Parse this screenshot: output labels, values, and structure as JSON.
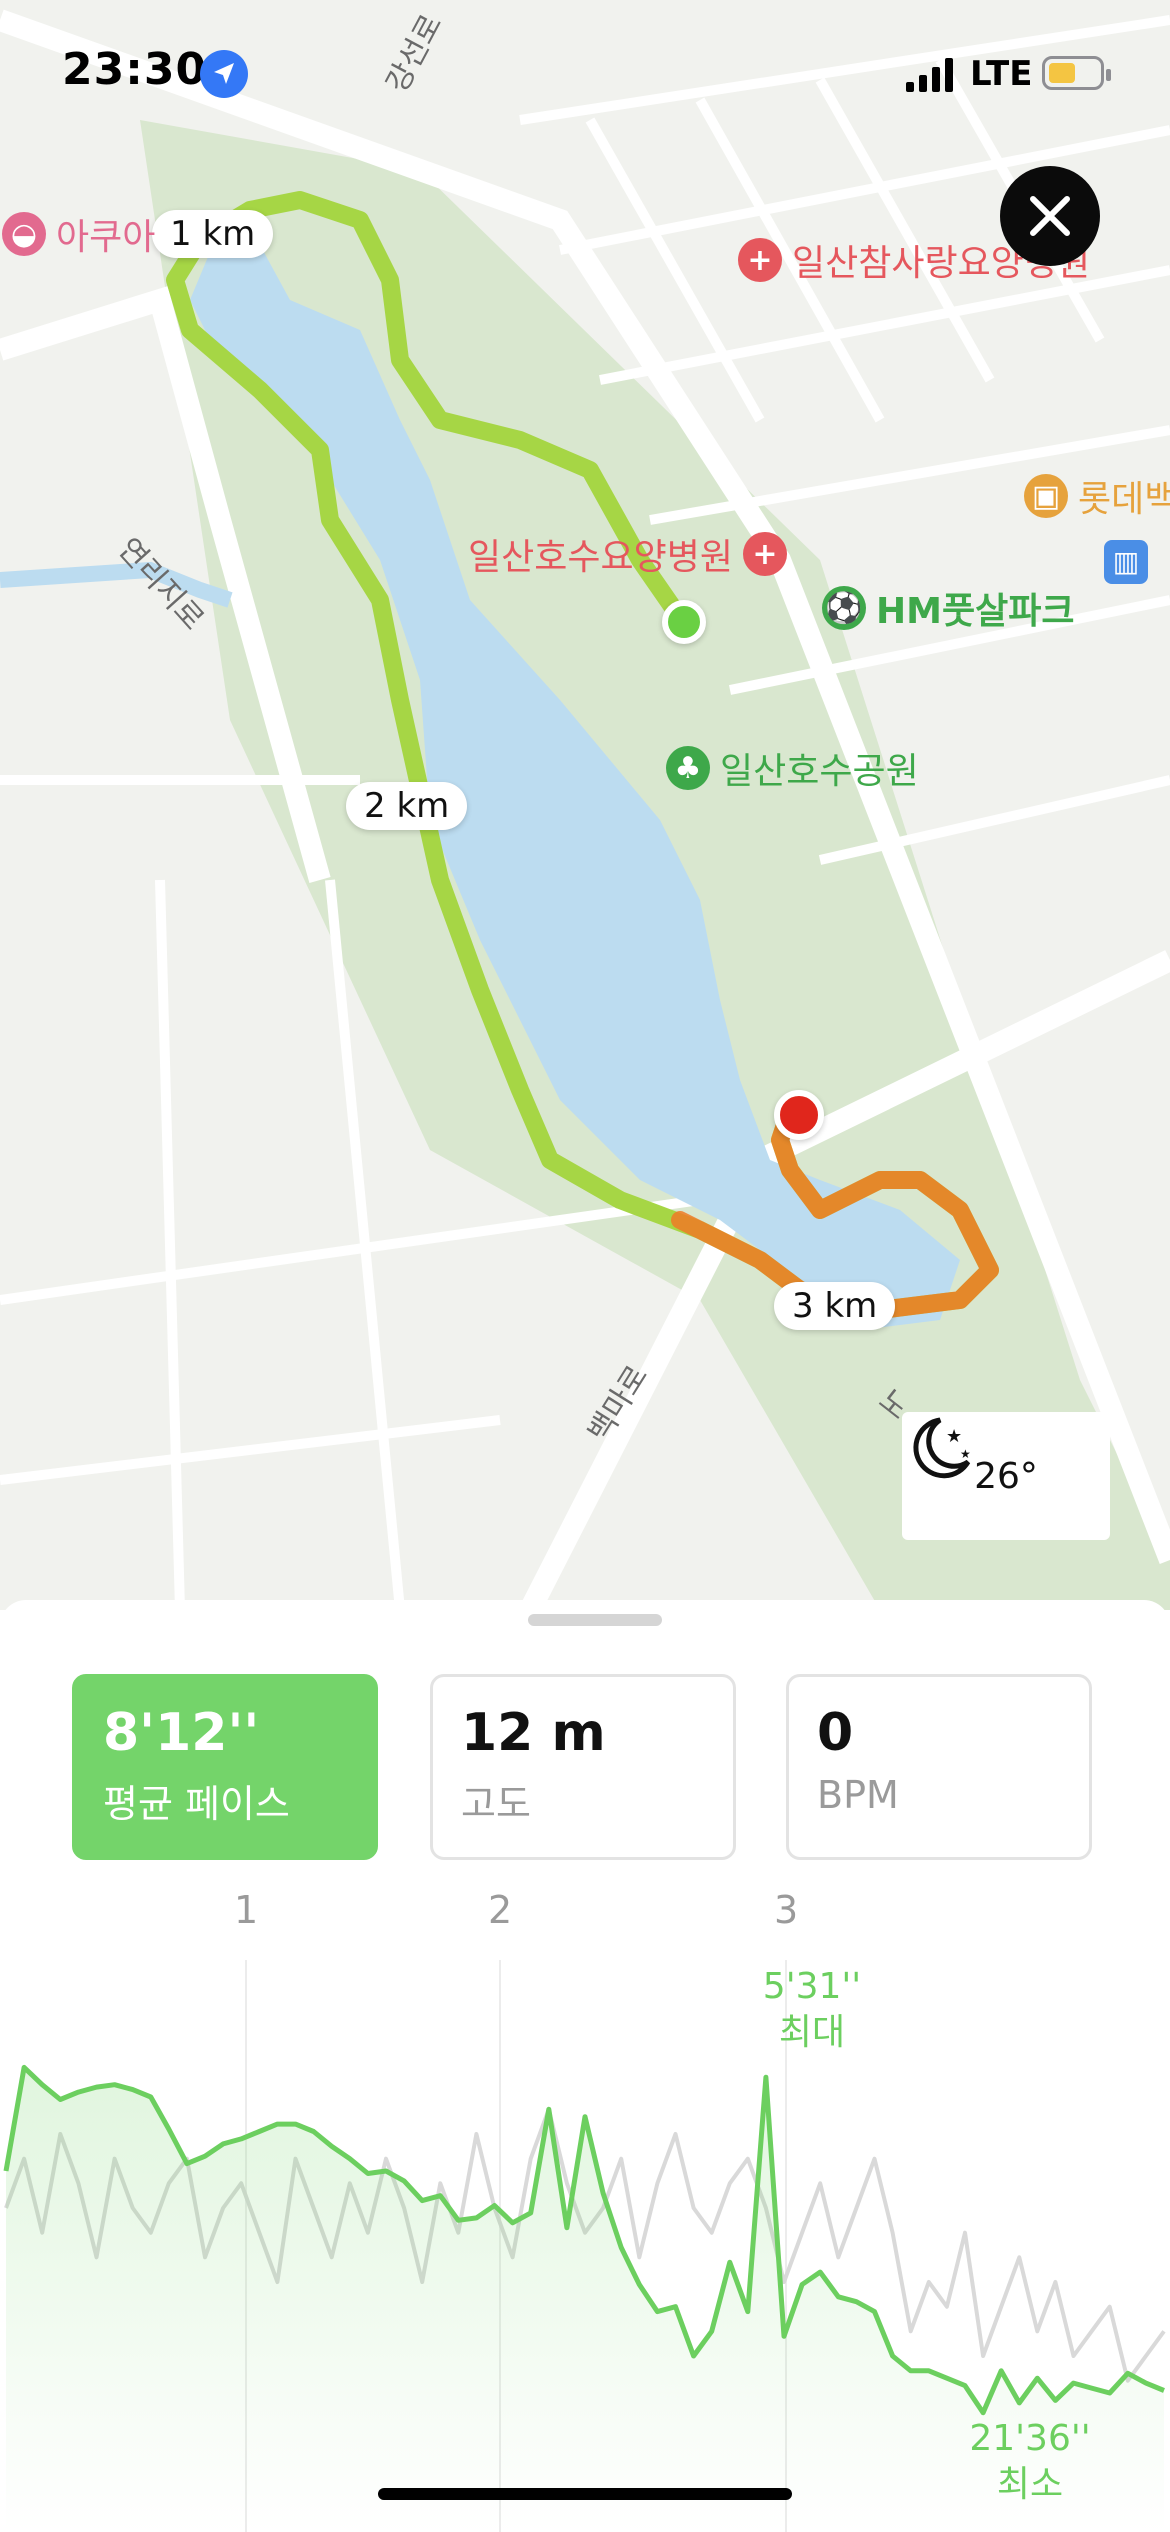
{
  "status": {
    "time": "23:30",
    "network": "LTE"
  },
  "map": {
    "km_markers": [
      "1 km",
      "2 km",
      "3 km"
    ],
    "pois": [
      {
        "name": "아쿠아",
        "color": "#e26a8f"
      },
      {
        "name": "일산참사랑요양병원",
        "color": "#e5575d"
      },
      {
        "name": "롯데백",
        "color": "#e6a23c"
      },
      {
        "name": "일산호수요양병원",
        "color": "#e5575d"
      },
      {
        "name": "HM풋살파크",
        "color": "#3ea84a"
      },
      {
        "name": "일산호수공원",
        "color": "#3ea84a"
      }
    ],
    "roads": [
      "강선로",
      "연리지로",
      "백마로",
      "노"
    ],
    "weather": {
      "temperature": "26°",
      "icon": "moon-stars-icon"
    }
  },
  "stats": [
    {
      "value": "8'12''",
      "label": "평균 페이스",
      "active": true
    },
    {
      "value": "12 m",
      "label": "고도",
      "active": false
    },
    {
      "value": "0",
      "label": "BPM",
      "active": false
    }
  ],
  "chart_data": {
    "type": "line",
    "x_ticks": [
      "1",
      "2",
      "3"
    ],
    "annotations": [
      {
        "value": "5'31''",
        "label": "최대"
      },
      {
        "value": "21'36''",
        "label": "최소"
      }
    ],
    "series": [
      {
        "color": "#6ccf5f",
        "values": [
          9.5,
          5.3,
          6.0,
          6.6,
          6.3,
          6.1,
          6.0,
          6.2,
          6.5,
          7.8,
          9.2,
          8.9,
          8.4,
          8.2,
          7.9,
          7.6,
          7.6,
          7.9,
          8.5,
          9.0,
          9.6,
          9.5,
          9.9,
          10.7,
          10.5,
          11.5,
          11.4,
          10.9,
          11.6,
          11.2,
          7.0,
          11.8,
          7.3,
          10.4,
          12.6,
          14.1,
          15.2,
          15.0,
          17.0,
          16.0,
          13.2,
          15.2,
          5.7,
          16.2,
          14.1,
          13.6,
          14.6,
          14.8,
          15.2,
          17.0,
          17.6,
          17.6,
          17.9,
          18.2,
          19.3,
          17.6,
          18.9,
          17.9,
          18.8,
          18.1,
          18.3,
          18.5,
          17.7,
          18.1,
          18.4
        ]
      },
      {
        "color": "#d9d9d9",
        "values": [
          11,
          9,
          12,
          8,
          10,
          13,
          9,
          11,
          12,
          10,
          9,
          13,
          11,
          10,
          12,
          14,
          9,
          11,
          13,
          10,
          12,
          9,
          11,
          14,
          10,
          12,
          8,
          11,
          13,
          9,
          7,
          10,
          12,
          11,
          9,
          13,
          10,
          8,
          11,
          12,
          10,
          9,
          11,
          14,
          12,
          10,
          13,
          11,
          9,
          12,
          16,
          14,
          15,
          12,
          17,
          15,
          13,
          16,
          14,
          17,
          16,
          15,
          18,
          17,
          16
        ]
      }
    ]
  }
}
